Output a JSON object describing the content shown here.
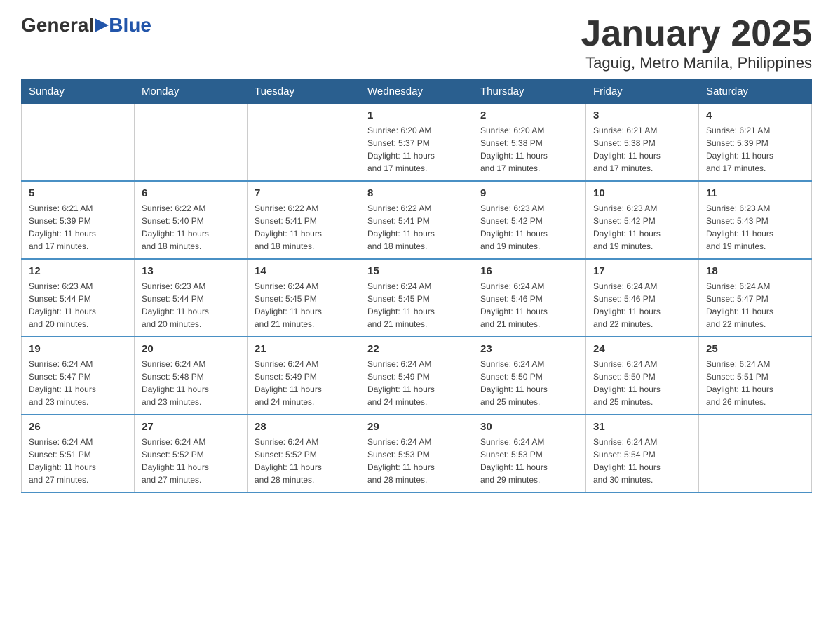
{
  "logo": {
    "general": "General",
    "blue": "Blue"
  },
  "title": "January 2025",
  "subtitle": "Taguig, Metro Manila, Philippines",
  "headers": [
    "Sunday",
    "Monday",
    "Tuesday",
    "Wednesday",
    "Thursday",
    "Friday",
    "Saturday"
  ],
  "weeks": [
    [
      {
        "day": "",
        "info": ""
      },
      {
        "day": "",
        "info": ""
      },
      {
        "day": "",
        "info": ""
      },
      {
        "day": "1",
        "info": "Sunrise: 6:20 AM\nSunset: 5:37 PM\nDaylight: 11 hours\nand 17 minutes."
      },
      {
        "day": "2",
        "info": "Sunrise: 6:20 AM\nSunset: 5:38 PM\nDaylight: 11 hours\nand 17 minutes."
      },
      {
        "day": "3",
        "info": "Sunrise: 6:21 AM\nSunset: 5:38 PM\nDaylight: 11 hours\nand 17 minutes."
      },
      {
        "day": "4",
        "info": "Sunrise: 6:21 AM\nSunset: 5:39 PM\nDaylight: 11 hours\nand 17 minutes."
      }
    ],
    [
      {
        "day": "5",
        "info": "Sunrise: 6:21 AM\nSunset: 5:39 PM\nDaylight: 11 hours\nand 17 minutes."
      },
      {
        "day": "6",
        "info": "Sunrise: 6:22 AM\nSunset: 5:40 PM\nDaylight: 11 hours\nand 18 minutes."
      },
      {
        "day": "7",
        "info": "Sunrise: 6:22 AM\nSunset: 5:41 PM\nDaylight: 11 hours\nand 18 minutes."
      },
      {
        "day": "8",
        "info": "Sunrise: 6:22 AM\nSunset: 5:41 PM\nDaylight: 11 hours\nand 18 minutes."
      },
      {
        "day": "9",
        "info": "Sunrise: 6:23 AM\nSunset: 5:42 PM\nDaylight: 11 hours\nand 19 minutes."
      },
      {
        "day": "10",
        "info": "Sunrise: 6:23 AM\nSunset: 5:42 PM\nDaylight: 11 hours\nand 19 minutes."
      },
      {
        "day": "11",
        "info": "Sunrise: 6:23 AM\nSunset: 5:43 PM\nDaylight: 11 hours\nand 19 minutes."
      }
    ],
    [
      {
        "day": "12",
        "info": "Sunrise: 6:23 AM\nSunset: 5:44 PM\nDaylight: 11 hours\nand 20 minutes."
      },
      {
        "day": "13",
        "info": "Sunrise: 6:23 AM\nSunset: 5:44 PM\nDaylight: 11 hours\nand 20 minutes."
      },
      {
        "day": "14",
        "info": "Sunrise: 6:24 AM\nSunset: 5:45 PM\nDaylight: 11 hours\nand 21 minutes."
      },
      {
        "day": "15",
        "info": "Sunrise: 6:24 AM\nSunset: 5:45 PM\nDaylight: 11 hours\nand 21 minutes."
      },
      {
        "day": "16",
        "info": "Sunrise: 6:24 AM\nSunset: 5:46 PM\nDaylight: 11 hours\nand 21 minutes."
      },
      {
        "day": "17",
        "info": "Sunrise: 6:24 AM\nSunset: 5:46 PM\nDaylight: 11 hours\nand 22 minutes."
      },
      {
        "day": "18",
        "info": "Sunrise: 6:24 AM\nSunset: 5:47 PM\nDaylight: 11 hours\nand 22 minutes."
      }
    ],
    [
      {
        "day": "19",
        "info": "Sunrise: 6:24 AM\nSunset: 5:47 PM\nDaylight: 11 hours\nand 23 minutes."
      },
      {
        "day": "20",
        "info": "Sunrise: 6:24 AM\nSunset: 5:48 PM\nDaylight: 11 hours\nand 23 minutes."
      },
      {
        "day": "21",
        "info": "Sunrise: 6:24 AM\nSunset: 5:49 PM\nDaylight: 11 hours\nand 24 minutes."
      },
      {
        "day": "22",
        "info": "Sunrise: 6:24 AM\nSunset: 5:49 PM\nDaylight: 11 hours\nand 24 minutes."
      },
      {
        "day": "23",
        "info": "Sunrise: 6:24 AM\nSunset: 5:50 PM\nDaylight: 11 hours\nand 25 minutes."
      },
      {
        "day": "24",
        "info": "Sunrise: 6:24 AM\nSunset: 5:50 PM\nDaylight: 11 hours\nand 25 minutes."
      },
      {
        "day": "25",
        "info": "Sunrise: 6:24 AM\nSunset: 5:51 PM\nDaylight: 11 hours\nand 26 minutes."
      }
    ],
    [
      {
        "day": "26",
        "info": "Sunrise: 6:24 AM\nSunset: 5:51 PM\nDaylight: 11 hours\nand 27 minutes."
      },
      {
        "day": "27",
        "info": "Sunrise: 6:24 AM\nSunset: 5:52 PM\nDaylight: 11 hours\nand 27 minutes."
      },
      {
        "day": "28",
        "info": "Sunrise: 6:24 AM\nSunset: 5:52 PM\nDaylight: 11 hours\nand 28 minutes."
      },
      {
        "day": "29",
        "info": "Sunrise: 6:24 AM\nSunset: 5:53 PM\nDaylight: 11 hours\nand 28 minutes."
      },
      {
        "day": "30",
        "info": "Sunrise: 6:24 AM\nSunset: 5:53 PM\nDaylight: 11 hours\nand 29 minutes."
      },
      {
        "day": "31",
        "info": "Sunrise: 6:24 AM\nSunset: 5:54 PM\nDaylight: 11 hours\nand 30 minutes."
      },
      {
        "day": "",
        "info": ""
      }
    ]
  ]
}
